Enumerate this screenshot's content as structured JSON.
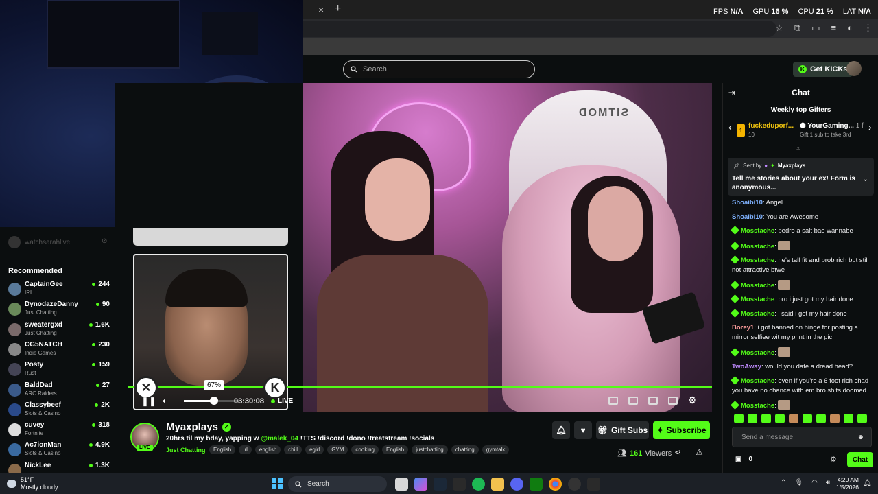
{
  "browser": {
    "tab_close": "×",
    "new_tab": "+",
    "perf": [
      {
        "label": "FPS",
        "value": "N/A"
      },
      {
        "label": "GPU",
        "value": "16 %"
      },
      {
        "label": "CPU",
        "value": "21 %"
      },
      {
        "label": "LAT",
        "value": "N/A"
      }
    ]
  },
  "kick_nav": {
    "search_placeholder": "Search",
    "get_kicks": "Get KICKs"
  },
  "sidebar": {
    "followed_channel": "watchsarahlive",
    "recommended_title": "Recommended",
    "channels": [
      {
        "name": "CaptainGee",
        "category": "IRL",
        "viewers": "244",
        "color": "#5a7a9a"
      },
      {
        "name": "DynodazeDanny",
        "category": "Just Chatting",
        "viewers": "90",
        "color": "#6a8a5a"
      },
      {
        "name": "sweatergxd",
        "category": "Just Chatting",
        "viewers": "1.6K",
        "color": "#7a6a6a"
      },
      {
        "name": "CG5NATCH",
        "category": "Indie Games",
        "viewers": "230",
        "color": "#888888"
      },
      {
        "name": "Posty",
        "category": "Rust",
        "viewers": "159",
        "color": "#444455"
      },
      {
        "name": "BaldDad",
        "category": "ARC Raiders",
        "viewers": "27",
        "color": "#3a5a8a"
      },
      {
        "name": "Classybeef",
        "category": "Slots & Casino",
        "viewers": "2K",
        "color": "#2a4a8a"
      },
      {
        "name": "cuvey",
        "category": "Fortnite",
        "viewers": "318",
        "color": "#dddddd"
      },
      {
        "name": "Ac7ionMan",
        "category": "Slots & Casino",
        "viewers": "4.9K",
        "color": "#3a6aa0"
      },
      {
        "name": "NickLee",
        "category": "",
        "viewers": "1.3K",
        "color": "#8a6a4a"
      }
    ]
  },
  "player": {
    "volume_pct": "67%",
    "volume_level": 0.67,
    "time": "03:30:08",
    "live": "LIVE"
  },
  "stream": {
    "name": "Myaxplays",
    "live_badge": "LIVE",
    "title_pre": "20hrs til my bday, yapping w ",
    "title_mention": "@malek_04",
    "title_post": " !TTS !discord !dono !treatstream !socials",
    "category": "Just Chatting",
    "tags": [
      "English",
      "Irl",
      "english",
      "chill",
      "egirl",
      "GYM",
      "cooking",
      "English",
      "justchatting",
      "chatting",
      "gymtalk"
    ],
    "gift_subs": "Gift Subs",
    "subscribe": "Subscribe",
    "viewer_count": "161",
    "viewers_label": "Viewers"
  },
  "chat": {
    "title": "Chat",
    "gifters_title": "Weekly top Gifters",
    "gifter1_name": "fuckeduporf...",
    "gifter1_count": "10",
    "gifter1_rank": "1",
    "gifter2_name": "YourGaming...",
    "gifter2_count": "1 f",
    "gifter_note": "Gift 1 sub to take 3rd",
    "pinned_by_label": "Sent by",
    "pinned_by_user": "Myaxplays",
    "pinned_msg": "Tell me stories about your ex! Form is anonymous...",
    "messages": [
      {
        "user": "Shoaibi10",
        "color": "#7fb2ff",
        "badge": false,
        "text": "Angel",
        "emote": false
      },
      {
        "user": "Shoaibi10",
        "color": "#7fb2ff",
        "badge": false,
        "text": "You are Awesome",
        "emote": false
      },
      {
        "user": "Mosstache",
        "color": "#53fc18",
        "badge": true,
        "text": "pedro a salt bae wannabe",
        "emote": false
      },
      {
        "user": "Mosstache",
        "color": "#53fc18",
        "badge": true,
        "text": "",
        "emote": true
      },
      {
        "user": "Mosstache",
        "color": "#53fc18",
        "badge": true,
        "text": "he's tall fit and prob rich but still not attractive btwe",
        "emote": false
      },
      {
        "user": "Mosstache",
        "color": "#53fc18",
        "badge": true,
        "text": "",
        "emote": true
      },
      {
        "user": "Mosstache",
        "color": "#53fc18",
        "badge": true,
        "text": "bro i just got my hair done",
        "emote": false
      },
      {
        "user": "Mosstache",
        "color": "#53fc18",
        "badge": true,
        "text": "i said i got my hair done",
        "emote": false
      },
      {
        "user": "Borey1",
        "color": "#ff9d9d",
        "badge": false,
        "text": "i got banned on hinge for posting a mirror selfiee wit my print in the pic",
        "emote": false
      },
      {
        "user": "Mosstache",
        "color": "#53fc18",
        "badge": true,
        "text": "",
        "emote": true
      },
      {
        "user": "TwoAway",
        "color": "#c08bff",
        "badge": false,
        "text": "would you date a dread head?",
        "emote": false
      },
      {
        "user": "Mosstache",
        "color": "#53fc18",
        "badge": true,
        "text": "even if you're a 6 foot rich chad you have no chance with em bro shits doomed",
        "emote": false
      },
      {
        "user": "Mosstache",
        "color": "#53fc18",
        "badge": true,
        "text": "",
        "emote": true
      }
    ],
    "send_placeholder": "Send a message",
    "count": "0",
    "chat_button": "Chat"
  },
  "taskbar": {
    "temp": "51°F",
    "weather": "Mostly cloudy",
    "search": "Search",
    "time": "4:20 AM",
    "date": "1/5/2026"
  }
}
